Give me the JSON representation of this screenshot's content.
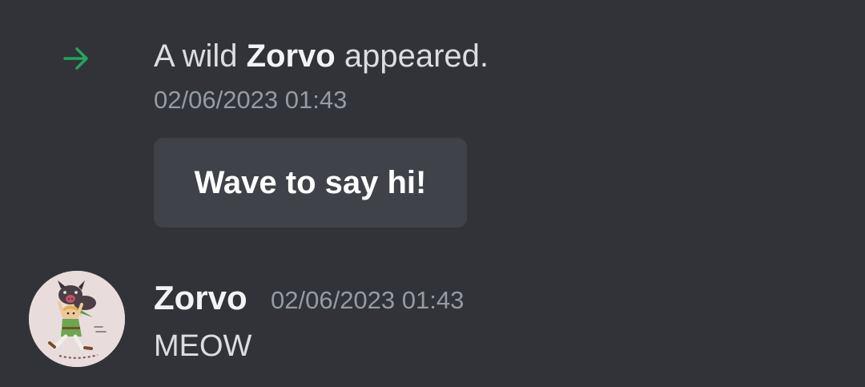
{
  "system_message": {
    "icon": "arrow-right-icon",
    "prefix": "A wild ",
    "name": "Zorvo",
    "suffix": " appeared.",
    "timestamp": "02/06/2023 01:43",
    "arrow_color": "#23a55a"
  },
  "wave_button": {
    "label": "Wave to say hi!"
  },
  "message": {
    "username": "Zorvo",
    "timestamp": "02/06/2023 01:43",
    "content": "MEOW",
    "avatar": "user-avatar-icon"
  }
}
